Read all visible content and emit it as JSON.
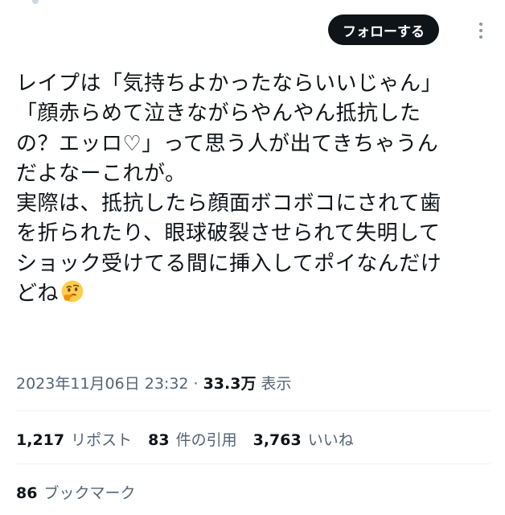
{
  "header": {
    "follow_label": "フォローする",
    "more_icon": "more-vertical-icon"
  },
  "tweet": {
    "lines": [
      "レイプは「気持ちよかったならいいじゃん」",
      "「顔赤らめて泣きながらやんやん抵抗した",
      "の？エッロ♡」って思う人が出てきちゃうん",
      "だよなーこれが。",
      "実際は、抵抗したら顔面ボコボコにされて歯",
      "を折られたり、眼球破裂させられて失明して",
      "ショック受けてる間に挿入してポイなんだけ",
      "どね"
    ],
    "emoji": "thinking-face"
  },
  "meta": {
    "timestamp": "2023年11月06日 23:32",
    "separator": "·",
    "views_count": "33.3万",
    "views_label": "表示"
  },
  "stats": {
    "reposts_count": "1,217",
    "reposts_label": "リポスト",
    "quotes_count": "83",
    "quotes_label": "件の引用",
    "likes_count": "3,763",
    "likes_label": "いいね",
    "bookmarks_count": "86",
    "bookmarks_label": "ブックマーク"
  },
  "colors": {
    "text_primary": "#0f1419",
    "text_secondary": "#536471",
    "follow_bg": "#0f1419",
    "divider": "#eff3f4"
  }
}
